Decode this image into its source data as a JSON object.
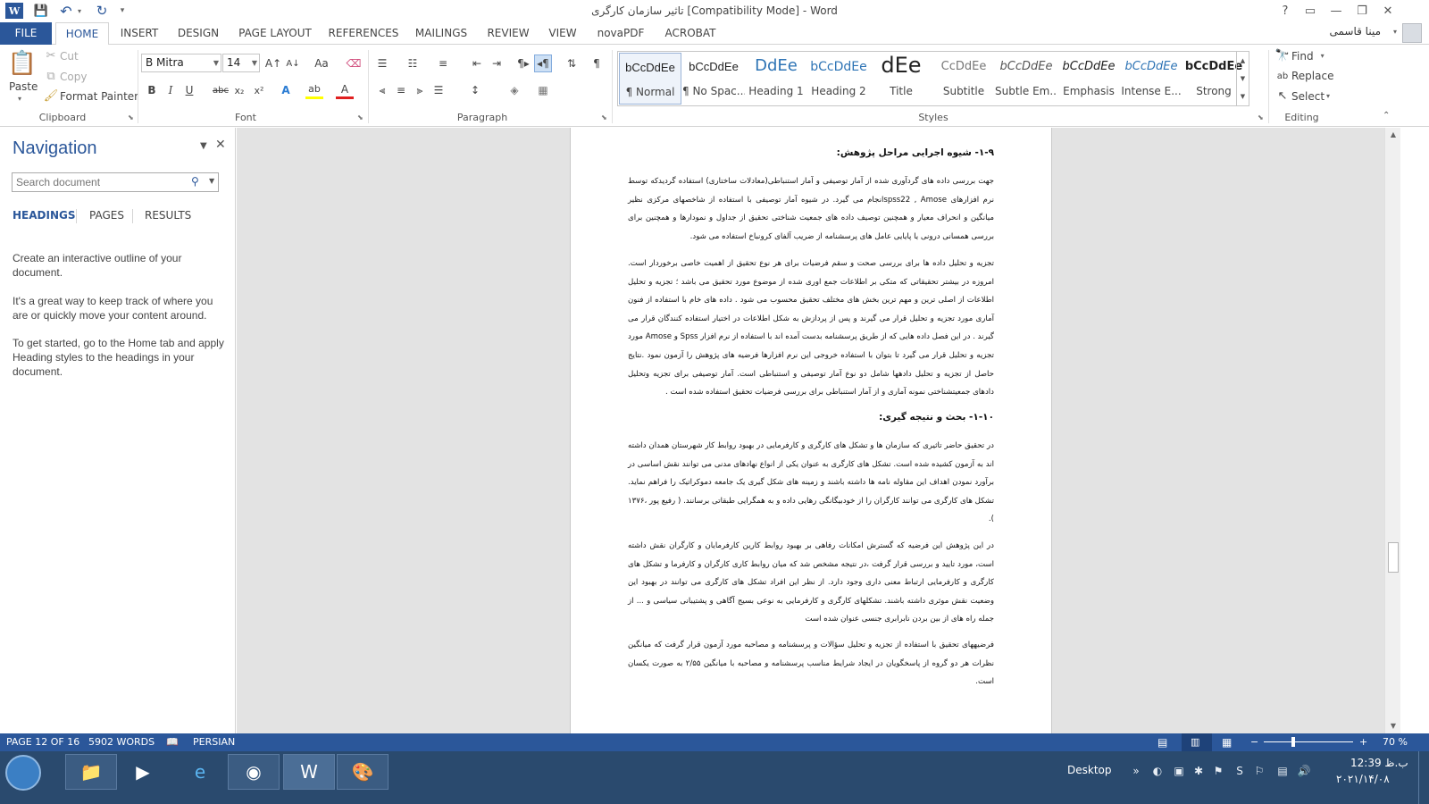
{
  "window": {
    "title": "تاثیر سازمان کارگری [Compatibility Mode] - Word",
    "help": "?",
    "ribbon_display": "▭",
    "minimize": "—",
    "restore": "❐",
    "close": "✕"
  },
  "quick_access": {
    "save": "💾",
    "undo": "↶",
    "redo": "↻",
    "customize": "▾"
  },
  "tabs": [
    "FILE",
    "HOME",
    "INSERT",
    "DESIGN",
    "PAGE LAYOUT",
    "REFERENCES",
    "MAILINGS",
    "REVIEW",
    "VIEW",
    "novaPDF",
    "ACROBAT"
  ],
  "user": {
    "name": "مینا قاسمی"
  },
  "clipboard": {
    "paste": "Paste",
    "cut": "Cut",
    "copy": "Copy",
    "format_painter": "Format Painter",
    "label": "Clipboard"
  },
  "font": {
    "name": "B Mitra",
    "size": "14",
    "label": "Font",
    "bold": "B",
    "italic": "I",
    "underline": "U",
    "strikethrough": "abc",
    "subscript": "x₂",
    "superscript": "x²",
    "grow": "A↑",
    "shrink": "A↓",
    "case": "Aa",
    "text_effects": "A",
    "highlight": "ab",
    "font_color": "A"
  },
  "paragraph": {
    "label": "Paragraph"
  },
  "styles": {
    "label": "Styles",
    "items": [
      {
        "preview": "bCcDdEe",
        "name": "¶ Normal"
      },
      {
        "preview": "bCcDdEe",
        "name": "¶ No Spac..."
      },
      {
        "preview": "DdEe",
        "name": "Heading 1"
      },
      {
        "preview": "bCcDdEe",
        "name": "Heading 2"
      },
      {
        "preview": "dEe",
        "name": "Title"
      },
      {
        "preview": "CcDdEe",
        "name": "Subtitle"
      },
      {
        "preview": "bCcDdEe",
        "name": "Subtle Em..."
      },
      {
        "preview": "bCcDdEe",
        "name": "Emphasis"
      },
      {
        "preview": "bCcDdEe",
        "name": "Intense E..."
      },
      {
        "preview": "bCcDdEe",
        "name": "Strong"
      }
    ]
  },
  "editing": {
    "label": "Editing",
    "find": "Find",
    "replace": "Replace",
    "select": "Select"
  },
  "navigation": {
    "title": "Navigation",
    "search_placeholder": "Search document",
    "tabs": [
      "HEADINGS",
      "PAGES",
      "RESULTS"
    ],
    "help": [
      "Create an interactive outline of your document.",
      "It's a great way to keep track of where you are or quickly move your content around.",
      "To get started, go to the Home tab and apply Heading styles to the headings in your document."
    ]
  },
  "document": {
    "heading1": "۱-۹- شیوه اجرایی مراحل پژوهش:",
    "para1": "جهت بررسی داده های گردآوری شده از آمار توصیفی و آمار استنباطی(معادلات ساختاری) استفاده گردیدکه توسط نرم افزارهای spss22 , Amoseانجام  می گیرد. در شیوه آمار توصیفی با استفاده از شاخصهای مرکزی نظیر میانگین و انحراف معیار و همچنین توصیف داده های جمعیت شناختی تحقیق از جداول و نمودارها و همچنین برای بررسی همسانی درونی یا پایایی عامل های پرسشنامه از ضریب آلفای کرونباخ استفاده می شود.",
    "para2": "تجزیه و تحلیل داده ها برای بررسی صحت و سقم فرضیات برای هر نوع تحقیق از اهمیت خاصی برخوردار است. امروزه در بیشتر تحقیقاتی که متکی بر اطلاعات جمع اوری شده از موضوع مورد تحقیق می باشد ؛ تجزیه و تحلیل اطلاعات از اصلی ترین و مهم ترین بخش های مختلف تحقیق محسوب می شود . داده های خام با استفاده از فنون آماری مورد تجزیه و تحلیل قرار می گیرند و پس از پردازش به شکل اطلاعات در اختیار استفاده کنندگان قرار می گیرند . در این فصل داده هایی که از طریق پرسشنامه بدست آمده اند با استفاده از نرم افزار Spss و Amose مورد تجزیه و تحلیل قرار می گیرد تا بتوان با استفاده خروجی این نرم افزارها فرضیه های پژوهش را آزمون نمود .نتایج حاصل از تجزیه و تحلیل دادهها شامل دو نوع آمار توصیفی و استنباطی است. آمار توصیفی برای تجزیه وتحلیل دادهای جمعیتشناختی نمونه آماری و از آمار استنباطی برای بررسی فرضیات تحقیق استفاده شده است .",
    "heading2": "۱-۱۰- بحث و نتیجه گیری:",
    "para3": "در تحقیق حاضر تاثیری که سازمان ها و تشکل های  کارگری و کارفرمایی در بهبود روابط کار شهرستان همدان داشته اند به آزمون کشیده شده است. تشکل های کارگری به عنوان یکی از انواع نهادهای مدنی می توانند نقش اساسی در برآورد نمودن اهداف این مقاوله نامه ها داشته باشند و زمینه های شکل گیری یک جامعه دموکراتیک را فراهم نماید. تشکل های کارگری می توانند کارگران را از خودبیگانگی رهایی داده و به همگرایی طبقاتی برسانند. ( رفیع پور ،۱۳۷۶ ).",
    "para4": "در این پژوهش این فرضیه که گسترش امکانات رفاهی بر بهبود روابط کارین کارفرمایان و کارگران نقش داشته است، مورد تایید  و بررسی قرار گرفت ،در نتیجه مشخص شد که میان روابط کاری کارگران و کارفرما و تشکل های کارگری و کارفرمایی ارتباط معنی داری وجود دارد. از نظر این افراد تشکل های کارگری می توانند در بهبود این وضعیت نقش موثری داشته باشند. تشکلهای کارگری و کارفرمایی به نوعی بسیج آگاهی و پشتیبانی سیاسی و ... از جمله راه های از بین بردن نابرابری جنسی عنوان شده است",
    "para5": "فرضیههای تحقیق با استفاده از تجزیه و تحلیل سؤالات و پرسشنامه و مصاحبه مورد آزمون قرار گرفت که میانگین نظرات هر دو گروه از پاسخگویان در ایجاد شرایط مناسب پرسشنامه و مصاحبه با میانگین ۲/۵۵ به صورت یکسان است."
  },
  "status": {
    "page": "PAGE 12 OF 16",
    "words": "5902 WORDS",
    "language": "PERSIAN",
    "zoom_minus": "−",
    "zoom_plus": "+",
    "zoom": "70 %",
    "zoom_level_percent": 70
  },
  "taskbar": {
    "desktop": "Desktop",
    "time": "12:39 ب.ظ",
    "date": "۲۰۲۱/۱۴/۰۸"
  },
  "colors": {
    "accent": "#2b579a",
    "taskbar": "#2a4a6e"
  }
}
